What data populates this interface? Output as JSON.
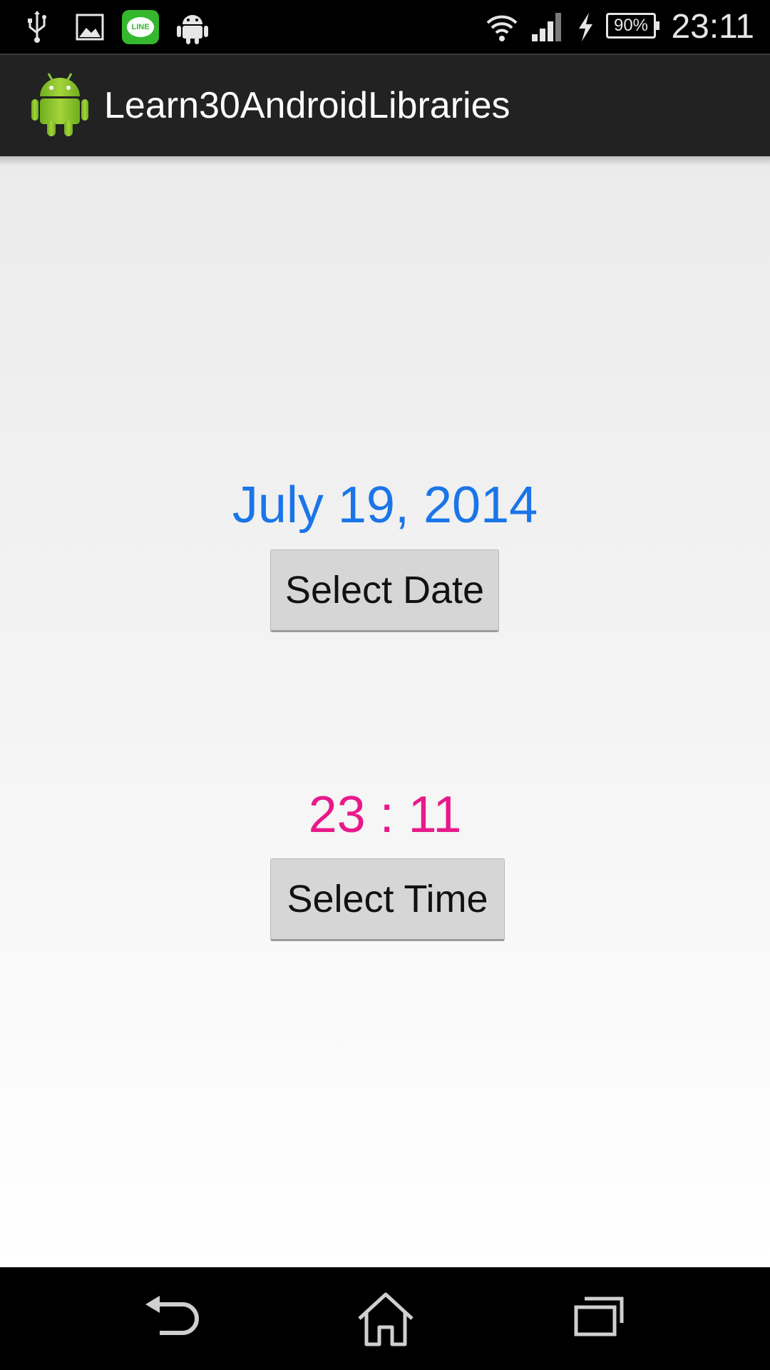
{
  "status_bar": {
    "icons": [
      "usb-icon",
      "gallery-icon",
      "line-app-icon",
      "android-debug-icon",
      "wifi-icon",
      "signal-icon",
      "charging-icon",
      "battery-icon"
    ],
    "line_label": "LINE",
    "battery": "90%",
    "time": "23:11"
  },
  "action_bar": {
    "app_icon": "android-icon",
    "title": "Learn30AndroidLibraries"
  },
  "main": {
    "date_value": "July 19, 2014",
    "select_date_label": "Select Date",
    "time_value": "23 : 11",
    "select_time_label": "Select Time"
  },
  "nav_bar": {
    "icons": [
      "back-icon",
      "home-icon",
      "recents-icon"
    ]
  },
  "colors": {
    "date_text": "#1a75e8",
    "time_text": "#e8198b",
    "action_bar": "#222222",
    "button": "#d6d6d6"
  }
}
